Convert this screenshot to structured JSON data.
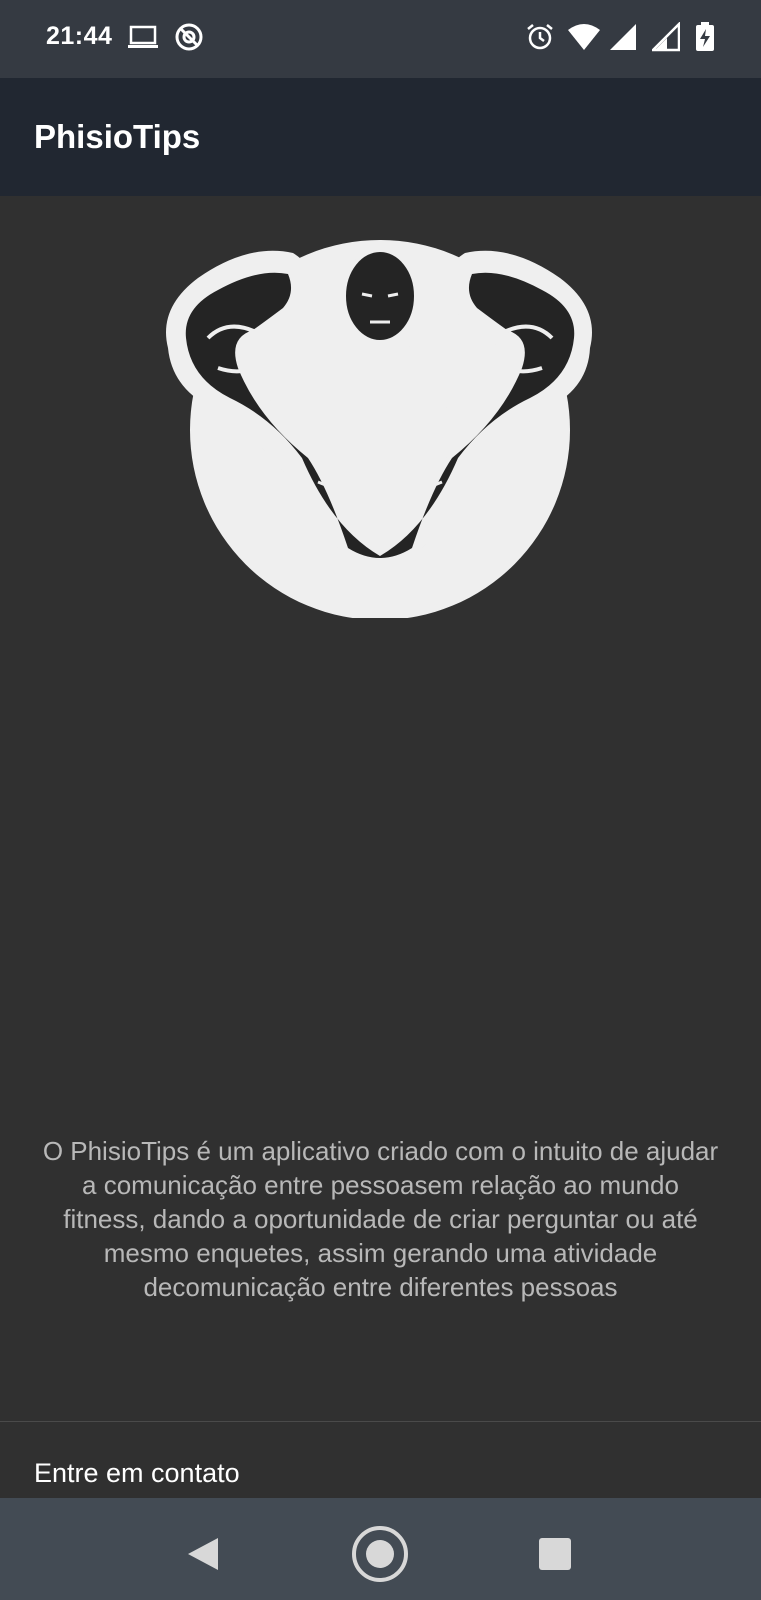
{
  "status_bar": {
    "time": "21:44",
    "left_icons": [
      "laptop-icon",
      "do-not-disturb-icon"
    ],
    "right_icons": [
      "alarm-icon",
      "wifi-icon",
      "signal-icon",
      "signal-icon",
      "battery-charging-icon"
    ]
  },
  "app_bar": {
    "title": "PhisioTips"
  },
  "main": {
    "logo_icon": "bodybuilder-logo-icon",
    "description": "O PhisioTips é um aplicativo criado com o intuito de ajudar a comunicação entre pessoasem relação ao mundo fitness, dando a oportunidade de criar perguntar ou até mesmo enquetes, assim gerando uma atividade decomunicação entre diferentes pessoas",
    "contact_label": "Entre em contato"
  },
  "nav_bar": {
    "buttons": [
      "back-icon",
      "home-icon",
      "recents-icon"
    ]
  },
  "colors": {
    "status_bar": "#353a42",
    "app_bar": "#212731",
    "background": "#303030",
    "nav_bar": "#434b54",
    "logo_fill": "#efefef"
  }
}
